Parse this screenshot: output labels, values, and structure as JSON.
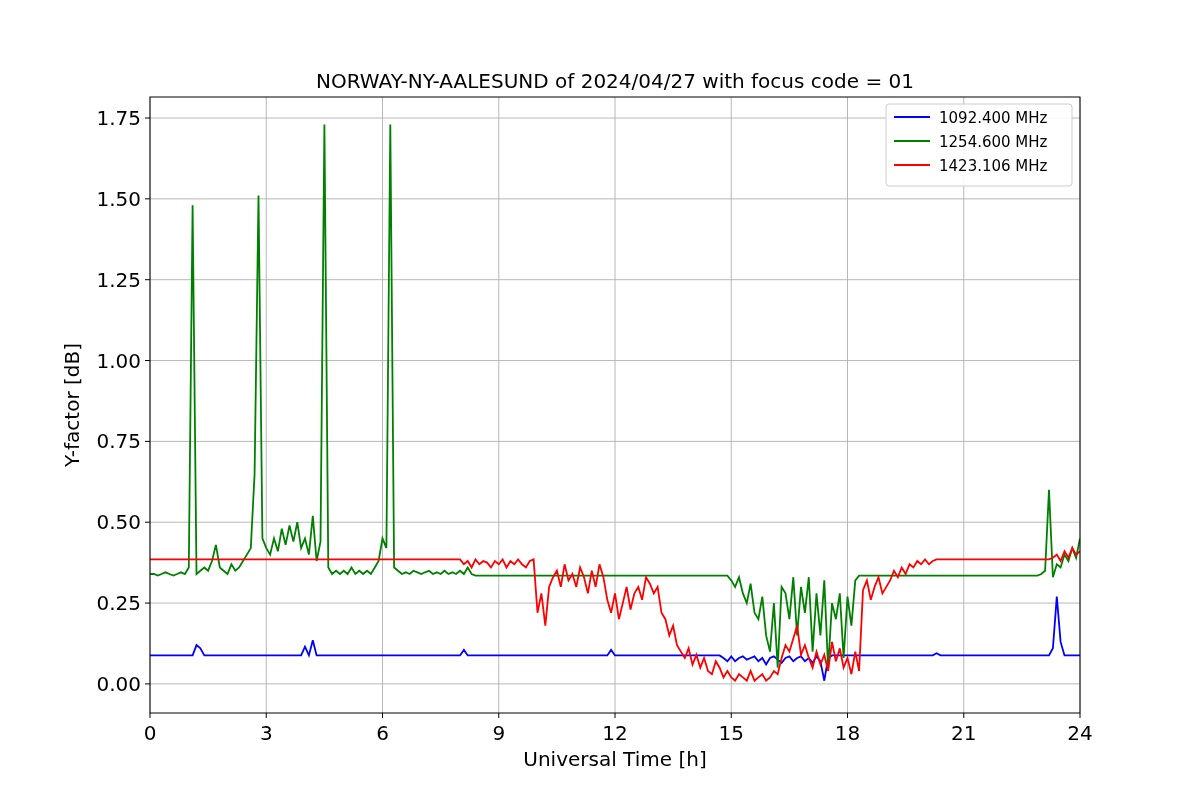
{
  "chart_data": {
    "type": "line",
    "title": "NORWAY-NY-AALESUND of 2024/04/27 with focus code = 01",
    "xlabel": "Universal Time [h]",
    "ylabel": "Y-factor [dB]",
    "grid": true,
    "legend": "upper right",
    "xlim": [
      0,
      24
    ],
    "ylim": [
      -0.09,
      1.815
    ],
    "xticks": [
      0,
      3,
      6,
      9,
      12,
      15,
      18,
      21,
      24
    ],
    "yticks": [
      {
        "value": 0,
        "label": "0.00"
      },
      {
        "value": 0.25,
        "label": "0.25"
      },
      {
        "value": 0.5,
        "label": "0.50"
      },
      {
        "value": 0.75,
        "label": "0.75"
      },
      {
        "value": 1,
        "label": "1.00"
      },
      {
        "value": 1.25,
        "label": "1.25"
      },
      {
        "value": 1.5,
        "label": "1.50"
      },
      {
        "value": 1.75,
        "label": "1.75"
      }
    ],
    "x": [
      0,
      0.1,
      0.2,
      0.3,
      0.4,
      0.5,
      0.6,
      0.7,
      0.8,
      0.9,
      1,
      1.1,
      1.2,
      1.3,
      1.4,
      1.5,
      1.6,
      1.7,
      1.8,
      1.9,
      2,
      2.1,
      2.2,
      2.3,
      2.4,
      2.5,
      2.6,
      2.7,
      2.8,
      2.9,
      3,
      3.1,
      3.2,
      3.3,
      3.4,
      3.5,
      3.6,
      3.7,
      3.8,
      3.9,
      4,
      4.1,
      4.2,
      4.3,
      4.4,
      4.5,
      4.6,
      4.7,
      4.8,
      4.9,
      5,
      5.1,
      5.2,
      5.3,
      5.4,
      5.5,
      5.6,
      5.7,
      5.8,
      5.9,
      6,
      6.1,
      6.2,
      6.3,
      6.4,
      6.5,
      6.6,
      6.7,
      6.8,
      6.9,
      7,
      7.1,
      7.2,
      7.3,
      7.4,
      7.5,
      7.6,
      7.7,
      7.8,
      7.9,
      8,
      8.1,
      8.2,
      8.3,
      8.4,
      8.5,
      8.6,
      8.7,
      8.8,
      8.9,
      9,
      9.1,
      9.2,
      9.3,
      9.4,
      9.5,
      9.6,
      9.7,
      9.8,
      9.9,
      10,
      10.1,
      10.2,
      10.3,
      10.4,
      10.5,
      10.6,
      10.7,
      10.8,
      10.9,
      11,
      11.1,
      11.2,
      11.3,
      11.4,
      11.5,
      11.6,
      11.7,
      11.8,
      11.9,
      12,
      12.1,
      12.2,
      12.3,
      12.4,
      12.5,
      12.6,
      12.7,
      12.8,
      12.9,
      13,
      13.1,
      13.2,
      13.3,
      13.4,
      13.5,
      13.6,
      13.7,
      13.8,
      13.9,
      14,
      14.1,
      14.2,
      14.3,
      14.4,
      14.5,
      14.6,
      14.7,
      14.8,
      14.9,
      15,
      15.1,
      15.2,
      15.3,
      15.4,
      15.5,
      15.6,
      15.7,
      15.8,
      15.9,
      16,
      16.1,
      16.2,
      16.3,
      16.4,
      16.5,
      16.6,
      16.7,
      16.8,
      16.9,
      17,
      17.1,
      17.2,
      17.3,
      17.4,
      17.5,
      17.6,
      17.7,
      17.8,
      17.9,
      18,
      18.1,
      18.2,
      18.3,
      18.4,
      18.5,
      18.6,
      18.7,
      18.8,
      18.9,
      19,
      19.1,
      19.2,
      19.3,
      19.4,
      19.5,
      19.6,
      19.7,
      19.8,
      19.9,
      20,
      20.1,
      20.2,
      20.3,
      20.4,
      20.5,
      20.6,
      20.7,
      20.8,
      20.9,
      21,
      21.1,
      21.2,
      21.3,
      21.4,
      21.5,
      21.6,
      21.7,
      21.8,
      21.9,
      22,
      22.1,
      22.2,
      22.3,
      22.4,
      22.5,
      22.6,
      22.7,
      22.8,
      22.9,
      23,
      23.1,
      23.2,
      23.3,
      23.4,
      23.5,
      23.6,
      23.7,
      23.8,
      23.9,
      24
    ],
    "series": [
      {
        "name": "1092.400 MHz",
        "color": "#0000ff",
        "values": [
          0.088,
          0.088,
          0.088,
          0.088,
          0.088,
          0.088,
          0.088,
          0.088,
          0.088,
          0.088,
          0.088,
          0.088,
          0.12,
          0.11,
          0.088,
          0.088,
          0.088,
          0.088,
          0.088,
          0.088,
          0.088,
          0.088,
          0.088,
          0.088,
          0.088,
          0.088,
          0.088,
          0.088,
          0.088,
          0.088,
          0.088,
          0.088,
          0.088,
          0.088,
          0.088,
          0.088,
          0.088,
          0.088,
          0.088,
          0.088,
          0.115,
          0.088,
          0.135,
          0.088,
          0.088,
          0.088,
          0.088,
          0.088,
          0.088,
          0.088,
          0.088,
          0.088,
          0.088,
          0.088,
          0.088,
          0.088,
          0.088,
          0.088,
          0.088,
          0.088,
          0.088,
          0.088,
          0.088,
          0.088,
          0.088,
          0.088,
          0.088,
          0.088,
          0.088,
          0.088,
          0.088,
          0.088,
          0.088,
          0.088,
          0.088,
          0.088,
          0.088,
          0.088,
          0.088,
          0.088,
          0.088,
          0.105,
          0.088,
          0.088,
          0.088,
          0.088,
          0.088,
          0.088,
          0.088,
          0.088,
          0.088,
          0.088,
          0.088,
          0.088,
          0.088,
          0.088,
          0.088,
          0.088,
          0.088,
          0.088,
          0.088,
          0.088,
          0.088,
          0.088,
          0.088,
          0.088,
          0.088,
          0.088,
          0.088,
          0.088,
          0.088,
          0.088,
          0.088,
          0.088,
          0.088,
          0.088,
          0.088,
          0.088,
          0.088,
          0.105,
          0.088,
          0.088,
          0.088,
          0.088,
          0.088,
          0.088,
          0.088,
          0.088,
          0.088,
          0.088,
          0.088,
          0.088,
          0.088,
          0.088,
          0.088,
          0.088,
          0.088,
          0.088,
          0.088,
          0.088,
          0.088,
          0.088,
          0.088,
          0.088,
          0.088,
          0.088,
          0.088,
          0.088,
          0.08,
          0.07,
          0.085,
          0.07,
          0.08,
          0.085,
          0.075,
          0.08,
          0.085,
          0.07,
          0.08,
          0.06,
          0.08,
          0.085,
          0.075,
          0.065,
          0.08,
          0.085,
          0.07,
          0.08,
          0.085,
          0.07,
          0.08,
          0.065,
          0.085,
          0.07,
          0.01,
          0.08,
          0.088,
          0.088,
          0.088,
          0.088,
          0.088,
          0.088,
          0.088,
          0.088,
          0.088,
          0.088,
          0.088,
          0.088,
          0.088,
          0.088,
          0.088,
          0.088,
          0.088,
          0.088,
          0.088,
          0.088,
          0.088,
          0.088,
          0.088,
          0.088,
          0.088,
          0.088,
          0.088,
          0.095,
          0.088,
          0.088,
          0.088,
          0.088,
          0.088,
          0.088,
          0.088,
          0.088,
          0.088,
          0.088,
          0.088,
          0.088,
          0.088,
          0.088,
          0.088,
          0.088,
          0.088,
          0.088,
          0.088,
          0.088,
          0.088,
          0.088,
          0.088,
          0.088,
          0.088,
          0.088,
          0.088,
          0.088,
          0.088,
          0.11,
          0.27,
          0.13,
          0.088,
          0.088,
          0.088,
          0.088,
          0.088
        ]
      },
      {
        "name": "1254.600 MHz",
        "color": "#008000",
        "values": [
          0.34,
          0.34,
          0.335,
          0.34,
          0.345,
          0.34,
          0.335,
          0.34,
          0.345,
          0.34,
          0.36,
          1.48,
          0.34,
          0.35,
          0.36,
          0.35,
          0.38,
          0.43,
          0.36,
          0.35,
          0.34,
          0.37,
          0.35,
          0.36,
          0.38,
          0.4,
          0.42,
          0.65,
          1.51,
          0.45,
          0.42,
          0.4,
          0.45,
          0.41,
          0.48,
          0.43,
          0.49,
          0.44,
          0.5,
          0.42,
          0.45,
          0.4,
          0.52,
          0.38,
          0.44,
          1.73,
          0.36,
          0.34,
          0.35,
          0.34,
          0.35,
          0.34,
          0.36,
          0.34,
          0.35,
          0.34,
          0.35,
          0.34,
          0.36,
          0.38,
          0.45,
          0.42,
          1.73,
          0.36,
          0.35,
          0.34,
          0.345,
          0.34,
          0.35,
          0.345,
          0.34,
          0.345,
          0.35,
          0.34,
          0.345,
          0.34,
          0.35,
          0.34,
          0.345,
          0.34,
          0.35,
          0.34,
          0.36,
          0.34,
          0.335,
          0.335,
          0.335,
          0.335,
          0.335,
          0.335,
          0.335,
          0.335,
          0.335,
          0.335,
          0.335,
          0.335,
          0.335,
          0.335,
          0.335,
          0.335,
          0.335,
          0.335,
          0.335,
          0.335,
          0.335,
          0.335,
          0.335,
          0.335,
          0.335,
          0.335,
          0.335,
          0.335,
          0.335,
          0.335,
          0.335,
          0.335,
          0.335,
          0.335,
          0.335,
          0.335,
          0.335,
          0.335,
          0.335,
          0.335,
          0.335,
          0.335,
          0.335,
          0.335,
          0.335,
          0.335,
          0.335,
          0.335,
          0.335,
          0.335,
          0.335,
          0.335,
          0.335,
          0.335,
          0.335,
          0.335,
          0.335,
          0.335,
          0.335,
          0.335,
          0.335,
          0.335,
          0.335,
          0.335,
          0.335,
          0.335,
          0.32,
          0.3,
          0.33,
          0.28,
          0.25,
          0.31,
          0.22,
          0.2,
          0.27,
          0.15,
          0.1,
          0.25,
          0.05,
          0.3,
          0.28,
          0.2,
          0.33,
          0.15,
          0.3,
          0.22,
          0.33,
          0.1,
          0.28,
          0.15,
          0.32,
          0.05,
          0.25,
          0.2,
          0.28,
          0.08,
          0.27,
          0.18,
          0.32,
          0.335,
          0.335,
          0.335,
          0.335,
          0.335,
          0.335,
          0.335,
          0.335,
          0.335,
          0.335,
          0.335,
          0.335,
          0.335,
          0.335,
          0.335,
          0.335,
          0.335,
          0.335,
          0.335,
          0.335,
          0.335,
          0.335,
          0.335,
          0.335,
          0.335,
          0.335,
          0.335,
          0.335,
          0.335,
          0.335,
          0.335,
          0.335,
          0.335,
          0.335,
          0.335,
          0.335,
          0.335,
          0.335,
          0.335,
          0.335,
          0.335,
          0.335,
          0.335,
          0.335,
          0.335,
          0.335,
          0.335,
          0.34,
          0.35,
          0.6,
          0.33,
          0.37,
          0.36,
          0.4,
          0.38,
          0.42,
          0.39,
          0.45
        ]
      },
      {
        "name": "1423.106 MHz",
        "color": "#ff0000",
        "values": [
          0.385,
          0.385,
          0.385,
          0.385,
          0.385,
          0.385,
          0.385,
          0.385,
          0.385,
          0.385,
          0.385,
          0.385,
          0.385,
          0.385,
          0.385,
          0.385,
          0.385,
          0.385,
          0.385,
          0.385,
          0.385,
          0.385,
          0.385,
          0.385,
          0.385,
          0.385,
          0.385,
          0.385,
          0.385,
          0.385,
          0.385,
          0.385,
          0.385,
          0.385,
          0.385,
          0.385,
          0.385,
          0.385,
          0.385,
          0.385,
          0.385,
          0.385,
          0.385,
          0.385,
          0.385,
          0.385,
          0.385,
          0.385,
          0.385,
          0.385,
          0.385,
          0.385,
          0.385,
          0.385,
          0.385,
          0.385,
          0.385,
          0.385,
          0.385,
          0.385,
          0.385,
          0.385,
          0.385,
          0.385,
          0.385,
          0.385,
          0.385,
          0.385,
          0.385,
          0.385,
          0.385,
          0.385,
          0.385,
          0.385,
          0.385,
          0.385,
          0.385,
          0.385,
          0.385,
          0.385,
          0.385,
          0.37,
          0.38,
          0.36,
          0.385,
          0.37,
          0.38,
          0.375,
          0.36,
          0.38,
          0.37,
          0.385,
          0.36,
          0.38,
          0.37,
          0.385,
          0.37,
          0.36,
          0.38,
          0.385,
          0.22,
          0.28,
          0.18,
          0.3,
          0.33,
          0.35,
          0.3,
          0.37,
          0.32,
          0.34,
          0.3,
          0.36,
          0.33,
          0.28,
          0.35,
          0.3,
          0.37,
          0.33,
          0.26,
          0.22,
          0.28,
          0.2,
          0.25,
          0.3,
          0.23,
          0.28,
          0.3,
          0.26,
          0.33,
          0.31,
          0.28,
          0.3,
          0.22,
          0.2,
          0.15,
          0.18,
          0.12,
          0.1,
          0.08,
          0.11,
          0.06,
          0.09,
          0.05,
          0.08,
          0.04,
          0.03,
          0.07,
          0.05,
          0.02,
          0.04,
          0.02,
          0.01,
          0.03,
          0.02,
          0.01,
          0.04,
          0.01,
          0.02,
          0.03,
          0.01,
          0.02,
          0.04,
          0.03,
          0.08,
          0.12,
          0.1,
          0.14,
          0.18,
          0.09,
          0.12,
          0.08,
          0.05,
          0.1,
          0.06,
          0.09,
          0.04,
          0.13,
          0.07,
          0.11,
          0.05,
          0.08,
          0.03,
          0.1,
          0.04,
          0.29,
          0.32,
          0.26,
          0.3,
          0.33,
          0.28,
          0.3,
          0.32,
          0.35,
          0.33,
          0.36,
          0.34,
          0.37,
          0.36,
          0.38,
          0.37,
          0.385,
          0.37,
          0.38,
          0.385,
          0.385,
          0.385,
          0.385,
          0.385,
          0.385,
          0.385,
          0.385,
          0.385,
          0.385,
          0.385,
          0.385,
          0.385,
          0.385,
          0.385,
          0.385,
          0.385,
          0.385,
          0.385,
          0.385,
          0.385,
          0.385,
          0.385,
          0.385,
          0.385,
          0.385,
          0.385,
          0.385,
          0.385,
          0.385,
          0.39,
          0.4,
          0.38,
          0.41,
          0.39,
          0.42,
          0.4,
          0.41
        ]
      }
    ]
  }
}
